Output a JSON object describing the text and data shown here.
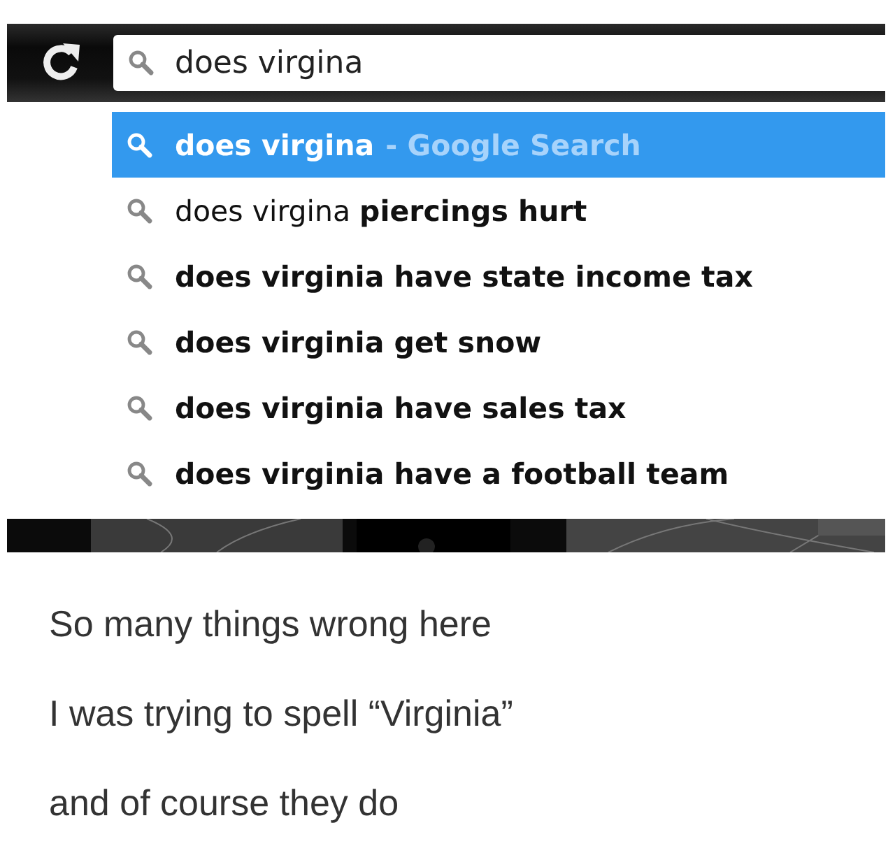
{
  "address_bar": {
    "value": "does virgina"
  },
  "suggestions": [
    {
      "text": "does virgina",
      "suffix": "- Google Search",
      "bold": true,
      "selected": true
    },
    {
      "text": "does virgina **piercings hurt**",
      "bold": false,
      "selected": false
    },
    {
      "text": "does virginia have state income tax",
      "bold": true,
      "selected": false
    },
    {
      "text": "does virginia get snow",
      "bold": true,
      "selected": false
    },
    {
      "text": "does virginia have sales tax",
      "bold": true,
      "selected": false
    },
    {
      "text": "does virginia have a football team",
      "bold": true,
      "selected": false
    }
  ],
  "caption": [
    "So many things wrong here",
    "I was trying to spell “Virginia”",
    "and of course they do"
  ]
}
